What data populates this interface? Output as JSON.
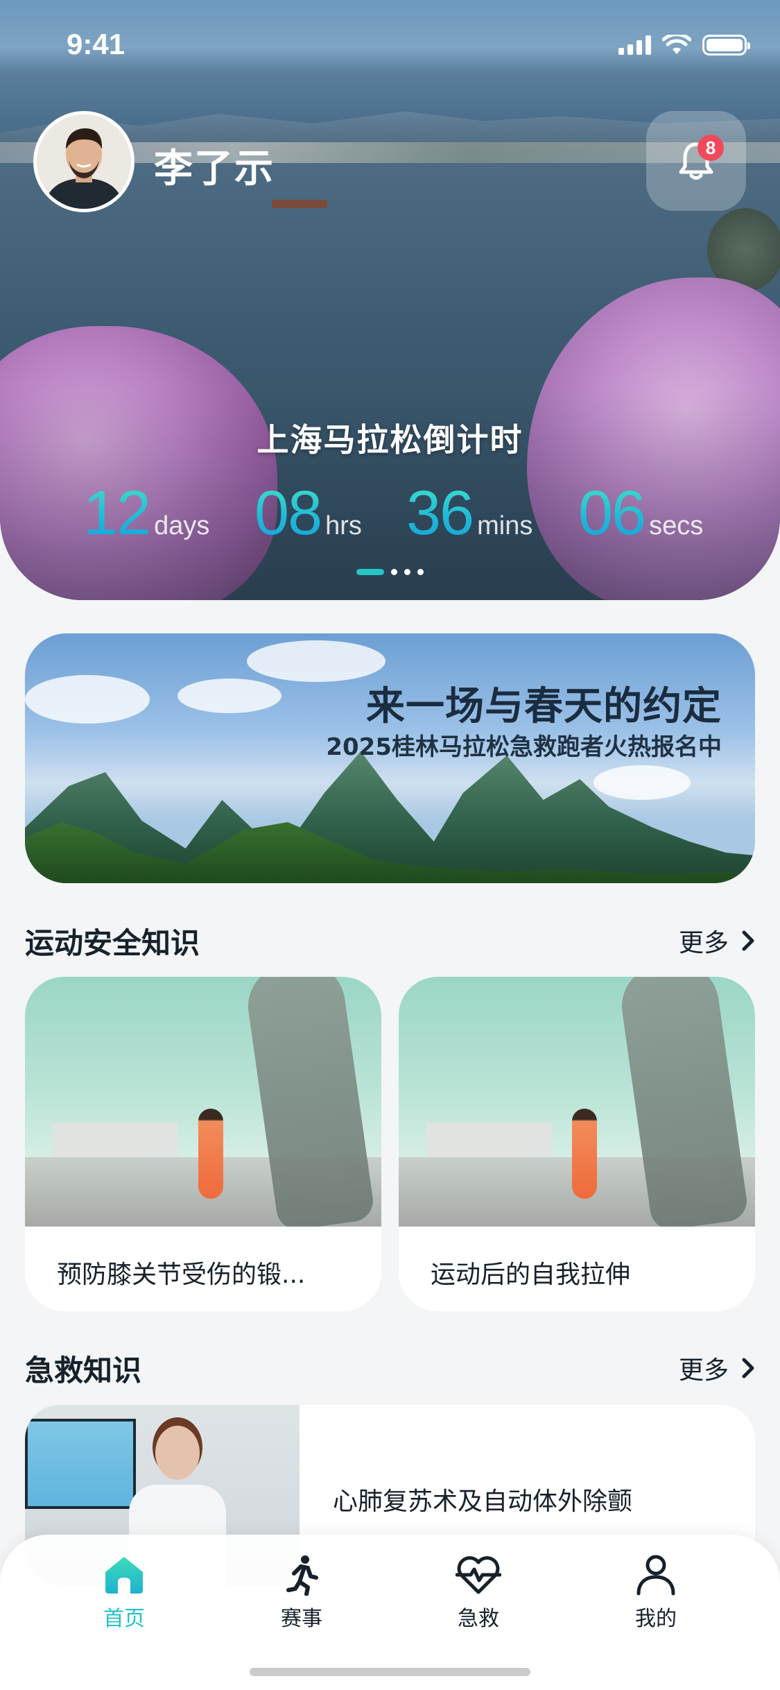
{
  "status_bar": {
    "time": "9:41"
  },
  "header": {
    "user_name": "李了示",
    "notification_count": "8"
  },
  "countdown": {
    "title": "上海马拉松倒计时",
    "units": [
      {
        "value": "12",
        "label": "days"
      },
      {
        "value": "08",
        "label": "hrs"
      },
      {
        "value": "36",
        "label": "mins"
      },
      {
        "value": "06",
        "label": "secs"
      }
    ],
    "carousel_page": 1,
    "carousel_total": 4
  },
  "banner": {
    "title": "来一场与春天的约定",
    "subtitle": "2025桂林马拉松急救跑者火热报名中"
  },
  "sports_safety": {
    "title": "运动安全知识",
    "more": "更多",
    "cards": [
      {
        "caption": "预防膝关节受伤的锻..."
      },
      {
        "caption": "运动后的自我拉伸"
      }
    ]
  },
  "first_aid": {
    "title": "急救知识",
    "more": "更多",
    "card": {
      "title": "心肺复苏术及自动体外除颤"
    }
  },
  "tabbar": {
    "active": "home",
    "active_color": "#23c1c4",
    "items": [
      {
        "id": "home",
        "label": "首页",
        "icon": "home-icon"
      },
      {
        "id": "events",
        "label": "赛事",
        "icon": "runner-icon"
      },
      {
        "id": "first-aid",
        "label": "急救",
        "icon": "heartbeat-icon"
      },
      {
        "id": "profile",
        "label": "我的",
        "icon": "user-icon"
      }
    ]
  }
}
